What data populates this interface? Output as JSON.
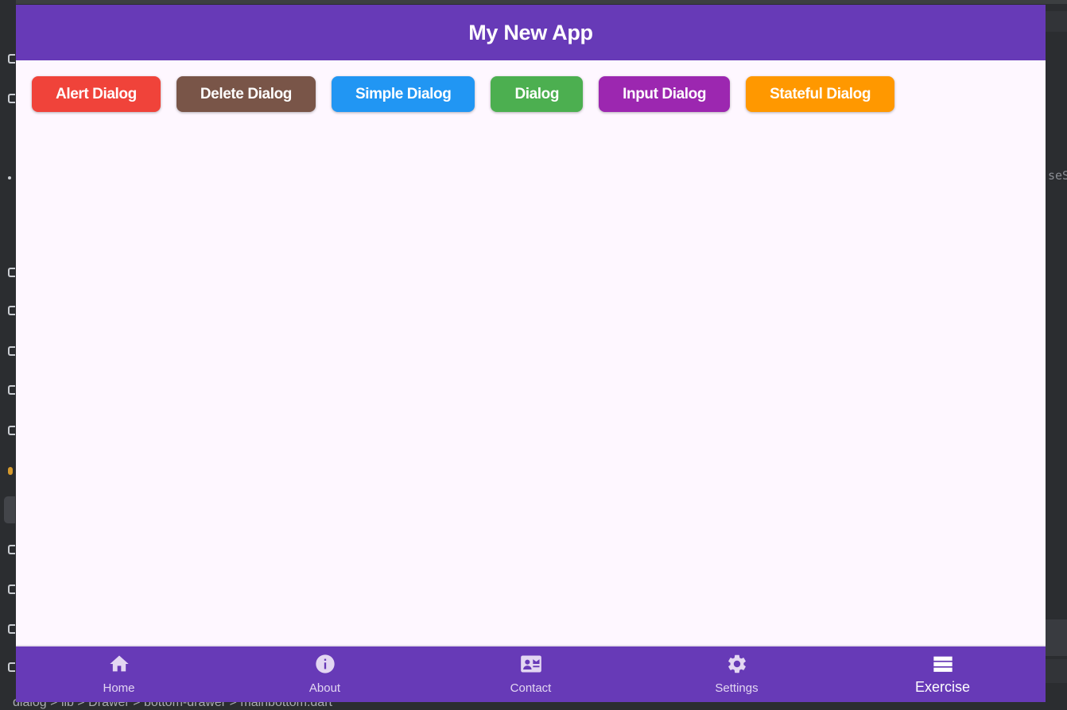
{
  "app": {
    "title": "My New App",
    "buttons": [
      {
        "label": "Alert Dialog",
        "color": "#f0433a"
      },
      {
        "label": "Delete Dialog",
        "color": "#795548"
      },
      {
        "label": "Simple Dialog",
        "color": "#2196f3"
      },
      {
        "label": "Dialog",
        "color": "#4caf50"
      },
      {
        "label": "Input Dialog",
        "color": "#9c27b0"
      },
      {
        "label": "Stateful Dialog",
        "color": "#ff9800"
      }
    ],
    "nav": [
      {
        "label": "Home",
        "icon": "home-icon"
      },
      {
        "label": "About",
        "icon": "info-icon"
      },
      {
        "label": "Contact",
        "icon": "contact-card-icon"
      },
      {
        "label": "Settings",
        "icon": "gear-icon"
      },
      {
        "label": "Exercise",
        "icon": "list-icon",
        "selected": true
      }
    ],
    "colors": {
      "primary": "#673ab7",
      "background": "#fef7ff"
    }
  },
  "ide": {
    "breadcrumb": "dialog  >  lib  >  Drawer  >  bottom-drawer  >  mainbottom.dart",
    "right_text": "seS"
  }
}
